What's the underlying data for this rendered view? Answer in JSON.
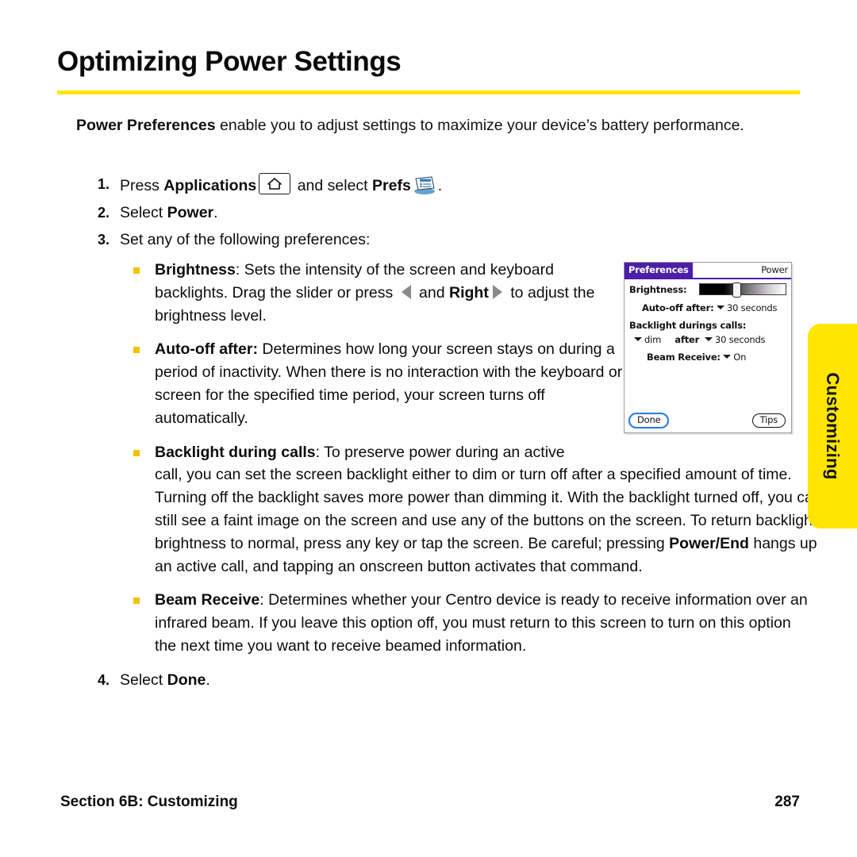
{
  "page": {
    "title": "Optimizing Power Settings",
    "accent_yellow": "#ffe500",
    "bullet_color": "#f2c200"
  },
  "intro": {
    "lead": "Power Preferences",
    "rest": " enable you to adjust settings to maximize your device’s battery performance."
  },
  "steps": [
    {
      "num": "1.",
      "pre": "Press ",
      "bold1": "Applications",
      "mid": " and select ",
      "bold2": "Prefs",
      "post": ".",
      "icons": [
        "home-key-icon",
        "prefs-app-icon"
      ]
    },
    {
      "num": "2.",
      "pre": "Select ",
      "bold1": "Power",
      "post": "."
    },
    {
      "num": "3.",
      "pre": "Set any of the following preferences:"
    },
    {
      "num": "4.",
      "pre": "Select ",
      "bold1": "Done",
      "post": "."
    }
  ],
  "bullets": [
    {
      "term": "Brightness",
      "text_a": ": Sets the intensity of the screen and keyboard backlights. Drag the slider or press ",
      "bold_left": "Left",
      "text_b": " and ",
      "bold_right": "Right",
      "text_c": " to adjust the brightness level."
    },
    {
      "term": "Auto-off after:",
      "text_a": " Determines how long your screen stays on during a period of inactivity. When there is no interaction with the keyboard or screen for the specified time period, your screen turns off automatically."
    },
    {
      "term": "Backlight during calls",
      "text_a": ": To preserve power during an active",
      "text_b": " call, you can set the screen backlight either to dim or turn off after a specified amount of time. Turning off the backlight saves more power than dimming it. With the backlight turned off, you can still see a faint image on the screen and use any of the buttons on the screen. To return backlight brightness to normal, press any key or tap the screen. Be careful; pressing ",
      "bold_mid": "Power/End",
      "text_c": " hangs up an active call, and tapping an onscreen button activates that command."
    },
    {
      "term": "Beam Receive",
      "text_a": ": Determines whether your Centro device is ready to receive information over an infrared beam. If you leave this option off, you must return to this screen to turn on this option the next time you want to receive beamed information."
    }
  ],
  "side_tab": {
    "label": "Customizing"
  },
  "device": {
    "titlebar": {
      "app": "Preferences",
      "screen": "Power"
    },
    "rows": {
      "brightness_label": "Brightness:",
      "autooff_label": "Auto-off after:",
      "autooff_value": "30 seconds",
      "backlight_label": "Backlight durings calls:",
      "backlight_mode": "dim",
      "backlight_after": "after",
      "backlight_value": "30 seconds",
      "beam_label": "Beam Receive:",
      "beam_value": "On"
    },
    "slider": {
      "position_percent": "42"
    },
    "buttons": {
      "done": "Done",
      "tips": "Tips"
    }
  },
  "footer": {
    "left": "Section 6B: Customizing",
    "page_number": "287"
  }
}
